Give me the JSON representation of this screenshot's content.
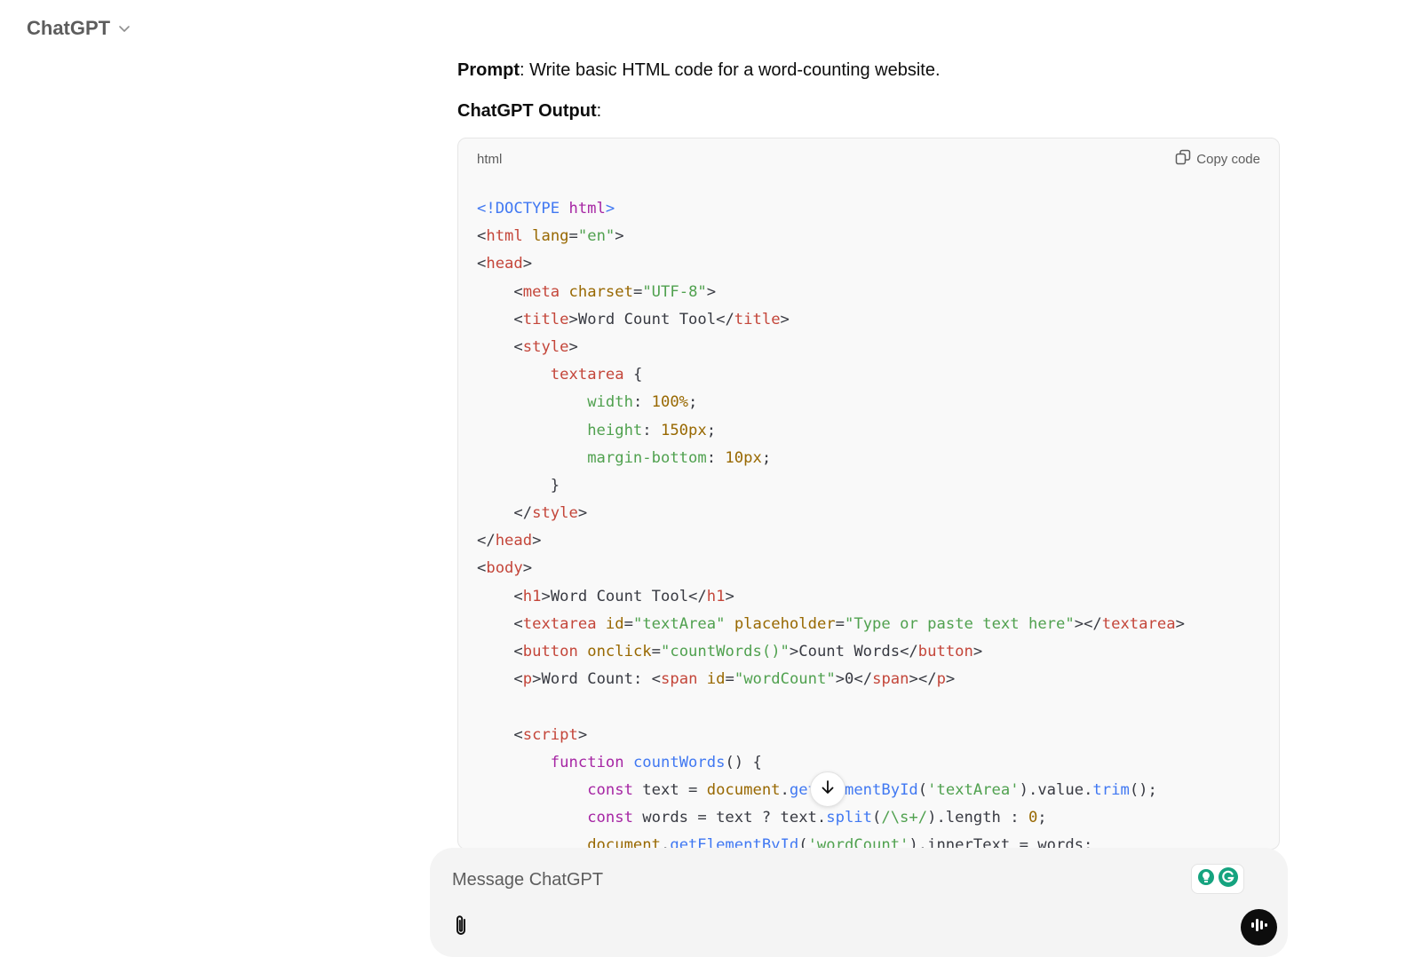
{
  "header": {
    "model_name": "ChatGPT",
    "model_icon": "chevron-down-icon"
  },
  "message": {
    "prompt_label": "Prompt",
    "prompt_sep": ": ",
    "prompt_text": "Write basic HTML code for a word-counting website.",
    "output_label": "ChatGPT Output",
    "output_sep": ":"
  },
  "code_block": {
    "language": "html",
    "copy_label": "Copy code",
    "copy_icon": "copy-icon",
    "lines": [
      [
        [
          "doctype",
          "<!DOCTYPE "
        ],
        [
          "doctype-kw",
          "html"
        ],
        [
          "doctype",
          ">"
        ]
      ],
      [
        [
          "punc",
          "<"
        ],
        [
          "tag",
          "html"
        ],
        [
          "text",
          " "
        ],
        [
          "attr",
          "lang"
        ],
        [
          "punc",
          "="
        ],
        [
          "str",
          "\"en\""
        ],
        [
          "punc",
          ">"
        ]
      ],
      [
        [
          "punc",
          "<"
        ],
        [
          "tag",
          "head"
        ],
        [
          "punc",
          ">"
        ]
      ],
      [
        [
          "text",
          "    "
        ],
        [
          "punc",
          "<"
        ],
        [
          "tag",
          "meta"
        ],
        [
          "text",
          " "
        ],
        [
          "attr",
          "charset"
        ],
        [
          "punc",
          "="
        ],
        [
          "str",
          "\"UTF-8\""
        ],
        [
          "punc",
          ">"
        ]
      ],
      [
        [
          "text",
          "    "
        ],
        [
          "punc",
          "<"
        ],
        [
          "tag",
          "title"
        ],
        [
          "punc",
          ">"
        ],
        [
          "text",
          "Word Count Tool"
        ],
        [
          "punc",
          "</"
        ],
        [
          "tag",
          "title"
        ],
        [
          "punc",
          ">"
        ]
      ],
      [
        [
          "text",
          "    "
        ],
        [
          "punc",
          "<"
        ],
        [
          "tag",
          "style"
        ],
        [
          "punc",
          ">"
        ]
      ],
      [
        [
          "text",
          "        "
        ],
        [
          "sel",
          "textarea"
        ],
        [
          "text",
          " {"
        ]
      ],
      [
        [
          "text",
          "            "
        ],
        [
          "prop",
          "width"
        ],
        [
          "text",
          ": "
        ],
        [
          "num",
          "100%"
        ],
        [
          "text",
          ";"
        ]
      ],
      [
        [
          "text",
          "            "
        ],
        [
          "prop",
          "height"
        ],
        [
          "text",
          ": "
        ],
        [
          "num",
          "150px"
        ],
        [
          "text",
          ";"
        ]
      ],
      [
        [
          "text",
          "            "
        ],
        [
          "prop",
          "margin-bottom"
        ],
        [
          "text",
          ": "
        ],
        [
          "num",
          "10px"
        ],
        [
          "text",
          ";"
        ]
      ],
      [
        [
          "text",
          "        }"
        ]
      ],
      [
        [
          "text",
          "    "
        ],
        [
          "punc",
          "</"
        ],
        [
          "tag",
          "style"
        ],
        [
          "punc",
          ">"
        ]
      ],
      [
        [
          "punc",
          "</"
        ],
        [
          "tag",
          "head"
        ],
        [
          "punc",
          ">"
        ]
      ],
      [
        [
          "punc",
          "<"
        ],
        [
          "tag",
          "body"
        ],
        [
          "punc",
          ">"
        ]
      ],
      [
        [
          "text",
          "    "
        ],
        [
          "punc",
          "<"
        ],
        [
          "tag",
          "h1"
        ],
        [
          "punc",
          ">"
        ],
        [
          "text",
          "Word Count Tool"
        ],
        [
          "punc",
          "</"
        ],
        [
          "tag",
          "h1"
        ],
        [
          "punc",
          ">"
        ]
      ],
      [
        [
          "text",
          "    "
        ],
        [
          "punc",
          "<"
        ],
        [
          "tag",
          "textarea"
        ],
        [
          "text",
          " "
        ],
        [
          "attr",
          "id"
        ],
        [
          "punc",
          "="
        ],
        [
          "str",
          "\"textArea\""
        ],
        [
          "text",
          " "
        ],
        [
          "attr",
          "placeholder"
        ],
        [
          "punc",
          "="
        ],
        [
          "str",
          "\"Type or paste text here\""
        ],
        [
          "punc",
          "></"
        ],
        [
          "tag",
          "textarea"
        ],
        [
          "punc",
          ">"
        ]
      ],
      [
        [
          "text",
          "    "
        ],
        [
          "punc",
          "<"
        ],
        [
          "tag",
          "button"
        ],
        [
          "text",
          " "
        ],
        [
          "attr",
          "onclick"
        ],
        [
          "punc",
          "="
        ],
        [
          "str",
          "\"countWords()\""
        ],
        [
          "punc",
          ">"
        ],
        [
          "text",
          "Count Words"
        ],
        [
          "punc",
          "</"
        ],
        [
          "tag",
          "button"
        ],
        [
          "punc",
          ">"
        ]
      ],
      [
        [
          "text",
          "    "
        ],
        [
          "punc",
          "<"
        ],
        [
          "tag",
          "p"
        ],
        [
          "punc",
          ">"
        ],
        [
          "text",
          "Word Count: "
        ],
        [
          "punc",
          "<"
        ],
        [
          "tag",
          "span"
        ],
        [
          "text",
          " "
        ],
        [
          "attr",
          "id"
        ],
        [
          "punc",
          "="
        ],
        [
          "str",
          "\"wordCount\""
        ],
        [
          "punc",
          ">"
        ],
        [
          "text",
          "0"
        ],
        [
          "punc",
          "</"
        ],
        [
          "tag",
          "span"
        ],
        [
          "punc",
          "></"
        ],
        [
          "tag",
          "p"
        ],
        [
          "punc",
          ">"
        ]
      ],
      [
        [
          "text",
          ""
        ]
      ],
      [
        [
          "text",
          "    "
        ],
        [
          "punc",
          "<"
        ],
        [
          "tag",
          "script"
        ],
        [
          "punc",
          ">"
        ]
      ],
      [
        [
          "text",
          "        "
        ],
        [
          "kw",
          "function"
        ],
        [
          "text",
          " "
        ],
        [
          "fn",
          "countWords"
        ],
        [
          "text",
          "() {"
        ]
      ],
      [
        [
          "text",
          "            "
        ],
        [
          "kw",
          "const"
        ],
        [
          "text",
          " text = "
        ],
        [
          "obj",
          "document"
        ],
        [
          "text",
          "."
        ],
        [
          "fn",
          "getElementById"
        ],
        [
          "text",
          "("
        ],
        [
          "str",
          "'textArea'"
        ],
        [
          "text",
          ")."
        ],
        [
          "text",
          "value"
        ],
        [
          "text",
          "."
        ],
        [
          "fn",
          "trim"
        ],
        [
          "text",
          "();"
        ]
      ],
      [
        [
          "text",
          "            "
        ],
        [
          "kw",
          "const"
        ],
        [
          "text",
          " words = text ? text."
        ],
        [
          "fn",
          "split"
        ],
        [
          "text",
          "("
        ],
        [
          "str",
          "/\\s+/"
        ],
        [
          "text",
          ").length : "
        ],
        [
          "num",
          "0"
        ],
        [
          "text",
          ";"
        ]
      ],
      [
        [
          "text",
          "            "
        ],
        [
          "obj",
          "document"
        ],
        [
          "text",
          "."
        ],
        [
          "fn",
          "getElementById"
        ],
        [
          "text",
          "("
        ],
        [
          "str",
          "'wordCount'"
        ],
        [
          "text",
          ")."
        ],
        [
          "text",
          "innerText = words;"
        ]
      ]
    ]
  },
  "scroll_button": {
    "icon": "arrow-down-icon"
  },
  "composer": {
    "placeholder": "Message ChatGPT",
    "attach_icon": "paperclip-icon",
    "voice_icon": "voice-mode-icon",
    "extension_icon": "grammarly-icon"
  }
}
